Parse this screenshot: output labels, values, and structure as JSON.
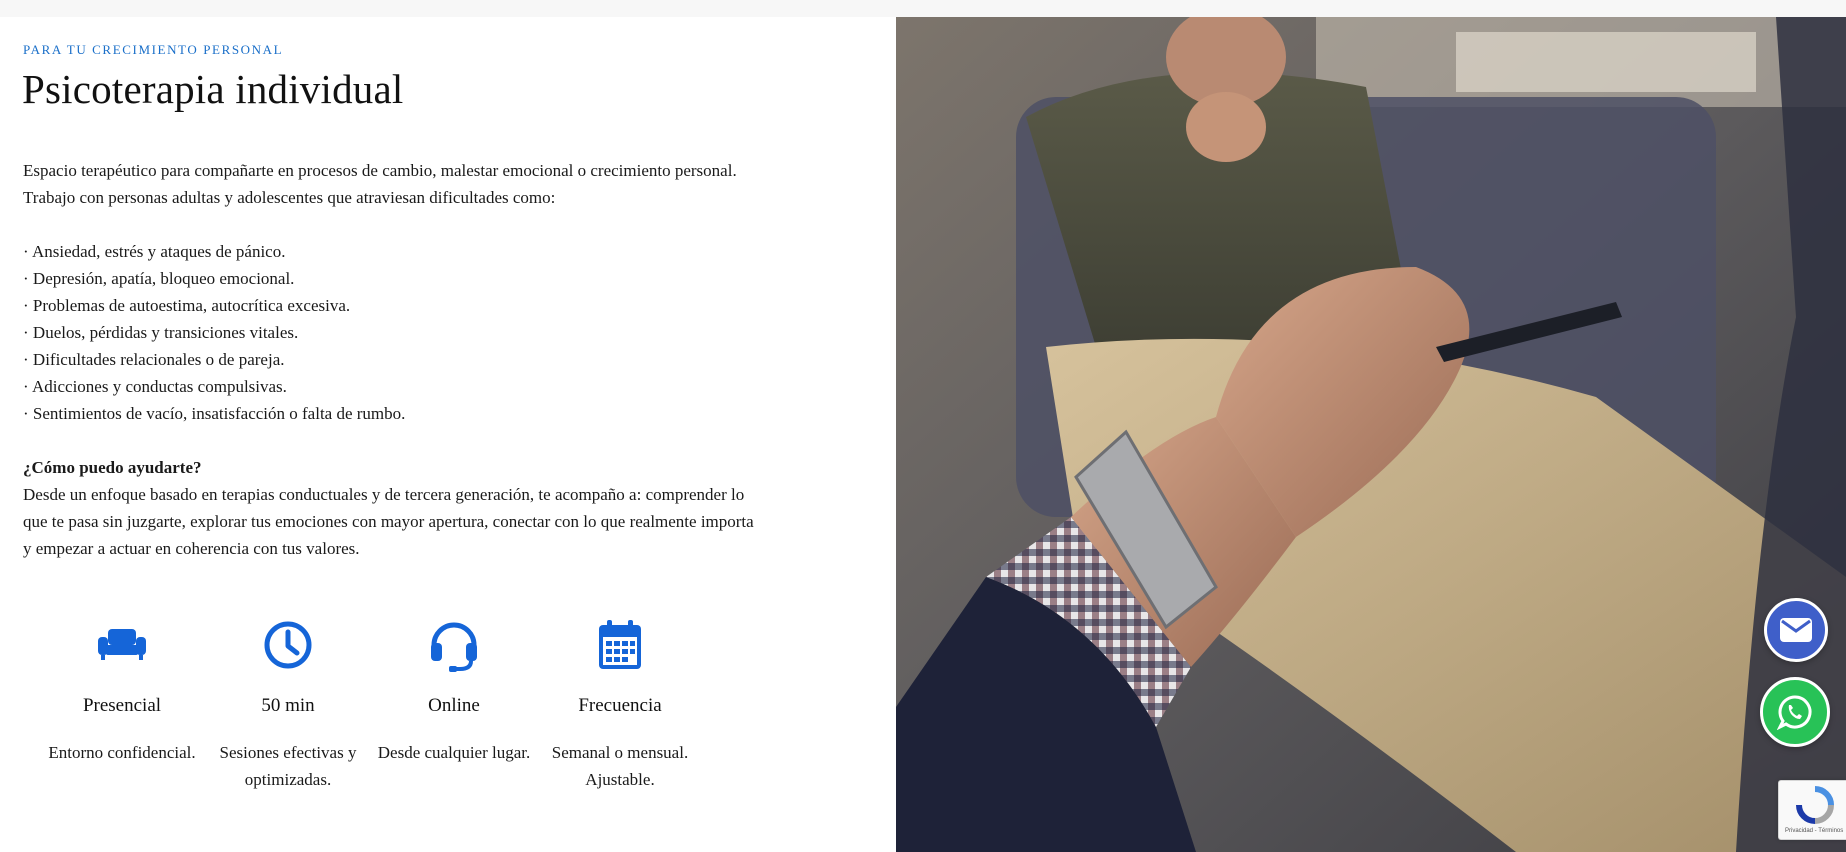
{
  "section": {
    "eyebrow": "PARA TU CRECIMIENTO PERSONAL",
    "title": "Psicoterapia individual",
    "intro": "Espacio terapéutico para compañarte en procesos de cambio, malestar emocional o crecimiento personal. Trabajo con personas adultas y adolescentes que atraviesan dificultades como:",
    "items": [
      "· Ansiedad, estrés y ataques de pánico.",
      "· Depresión, apatía, bloqueo emocional.",
      "· Problemas de autoestima, autocrítica excesiva.",
      "· Duelos, pérdidas y transiciones vitales.",
      "· Dificultades relacionales o de pareja.",
      "· Adicciones y conductas compulsivas.",
      "· Sentimientos de vacío, insatisfacción o falta de rumbo."
    ],
    "help_heading": "¿Cómo puedo ayudarte?",
    "help_text": "Desde un enfoque basado en terapias conductuales y de tercera generación, te acompaño a: comprender lo que te pasa sin juzgarte, explorar tus emociones con mayor apertura, conectar con lo que realmente importa y empezar a actuar en coherencia con tus valores."
  },
  "features": [
    {
      "icon": "sofa-icon",
      "name": "Presencial",
      "desc": "Entorno confidencial."
    },
    {
      "icon": "clock-icon",
      "name": "50 min",
      "desc": "Sesiones efectivas y optimizadas."
    },
    {
      "icon": "headset-icon",
      "name": "Online",
      "desc": "Desde cualquier lugar."
    },
    {
      "icon": "calendar-icon",
      "name": "Frecuencia",
      "desc": "Semanal o mensual. Ajustable."
    }
  ],
  "floating": {
    "mail_icon": "mail-icon",
    "whatsapp_icon": "whatsapp-icon"
  },
  "recaptcha": {
    "text": "Privacidad - Términos"
  },
  "colors": {
    "accent": "#1a6fc9",
    "icon_blue": "#1565d8",
    "mail_button": "#3f5fc9",
    "whatsapp_button": "#28c257"
  }
}
